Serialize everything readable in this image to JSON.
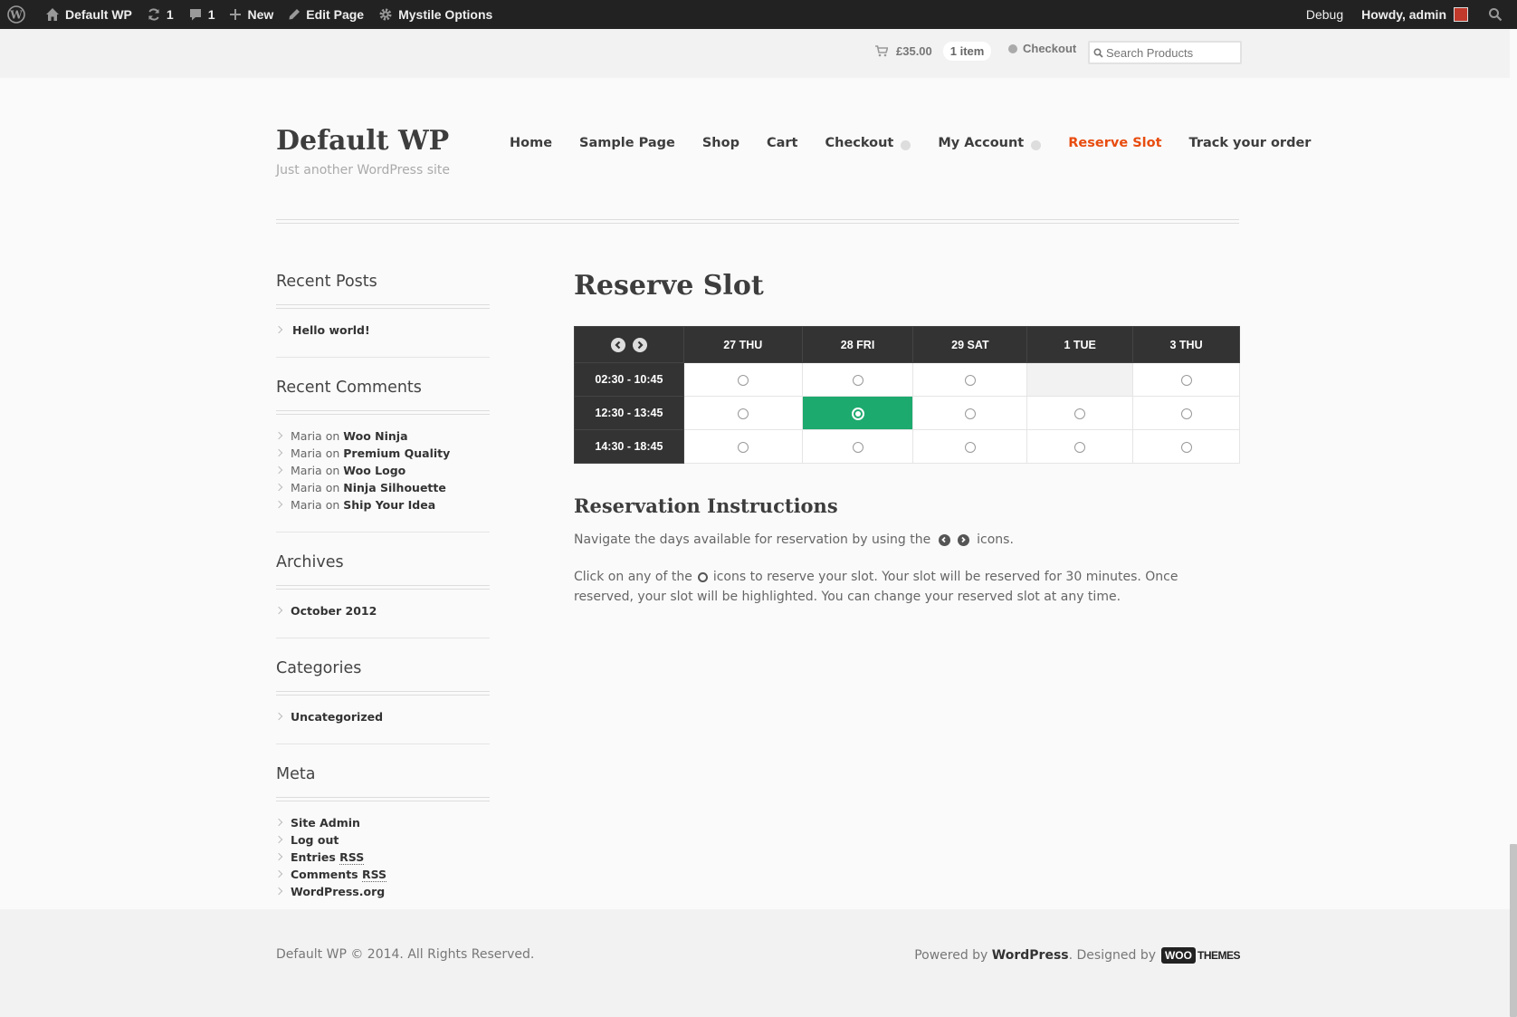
{
  "adminbar": {
    "site_name": "Default WP",
    "updates_count": "1",
    "comments_count": "1",
    "new_label": "New",
    "edit_label": "Edit Page",
    "options_label": "Mystile Options",
    "debug_label": "Debug",
    "howdy_label": "Howdy, admin"
  },
  "topbar": {
    "cart_total": "£35.00",
    "cart_count": "1 item",
    "checkout_label": "Checkout",
    "search_placeholder": "Search Products"
  },
  "header": {
    "site_title": "Default WP",
    "site_description": "Just another WordPress site",
    "nav": [
      {
        "label": "Home"
      },
      {
        "label": "Sample Page"
      },
      {
        "label": "Shop"
      },
      {
        "label": "Cart"
      },
      {
        "label": "Checkout"
      },
      {
        "label": "My Account"
      },
      {
        "label": "Reserve Slot"
      },
      {
        "label": "Track your order"
      }
    ]
  },
  "sidebar": {
    "recent_posts": {
      "title": "Recent Posts",
      "items": [
        "Hello world!"
      ]
    },
    "recent_comments": {
      "title": "Recent Comments",
      "items": [
        {
          "author": "Maria",
          "on": "on",
          "post": "Woo Ninja"
        },
        {
          "author": "Maria",
          "on": "on",
          "post": "Premium Quality"
        },
        {
          "author": "Maria",
          "on": "on",
          "post": "Woo Logo"
        },
        {
          "author": "Maria",
          "on": "on",
          "post": "Ninja Silhouette"
        },
        {
          "author": "Maria",
          "on": "on",
          "post": "Ship Your Idea"
        }
      ]
    },
    "archives": {
      "title": "Archives",
      "items": [
        "October 2012"
      ]
    },
    "categories": {
      "title": "Categories",
      "items": [
        "Uncategorized"
      ]
    },
    "meta": {
      "title": "Meta",
      "items": [
        {
          "text": "Site Admin"
        },
        {
          "text": "Log out"
        },
        {
          "text": "Entries",
          "abbr": "RSS"
        },
        {
          "text": "Comments",
          "abbr": "RSS"
        },
        {
          "text": "WordPress.org"
        }
      ]
    }
  },
  "main": {
    "page_title": "Reserve Slot",
    "table": {
      "days": [
        "27 THU",
        "28 FRI",
        "29 SAT",
        "1 TUE",
        "3 THU"
      ],
      "times": [
        "02:30 - 10:45",
        "12:30 - 13:45",
        "14:30 - 18:45"
      ],
      "selected": {
        "row": 1,
        "col": 1
      },
      "disabled": [
        {
          "row": 0,
          "col": 3
        }
      ]
    },
    "instructions_title": "Reservation Instructions",
    "instr1_before": "Navigate the days available for reservation by using the",
    "instr1_after": "icons.",
    "instr2_before": "Click on any of the",
    "instr2_after": "icons to reserve your slot. Your slot will be reserved for 30 minutes. Once reserved, your slot will be highlighted. You can change your reserved slot at any time."
  },
  "footer": {
    "copyright": "Default WP © 2014. All Rights Reserved.",
    "powered_by": "Powered by",
    "wordpress": "WordPress",
    "designed_by": ". Designed by",
    "woo": "WOO",
    "themes": "THEMES"
  },
  "colors": {
    "accent": "#e84c0f",
    "selected_slot": "#1daa6e",
    "dark": "#333333"
  }
}
